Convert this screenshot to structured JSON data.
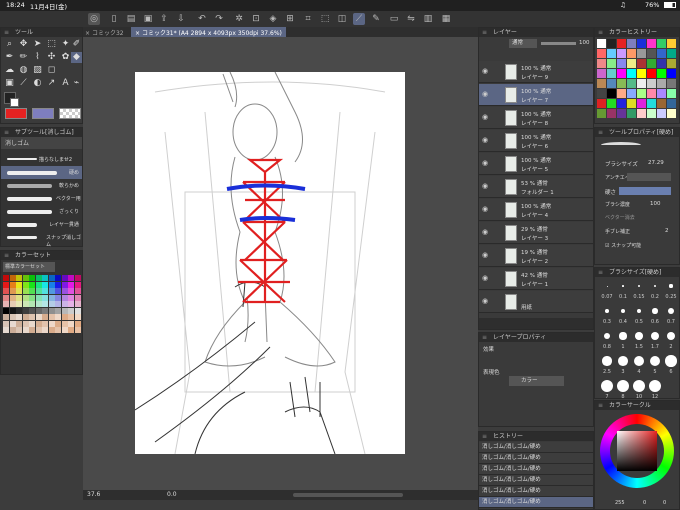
{
  "status": {
    "time": "18:24",
    "date": "11月4日(金)",
    "battery": "76%"
  },
  "tabs": [
    {
      "label": "コミック32"
    },
    {
      "label": "コミック31* (A4 2894 x 4093px 350dpi 37.6%)"
    }
  ],
  "tool_panel": {
    "title": "ツール"
  },
  "subtool": {
    "title": "サブツール[消しゴム]",
    "tab": "消しゴム",
    "items": [
      "描らなしませ2",
      "硬め",
      "軟らかめ",
      "ベクター用",
      "ざっくり",
      "レイヤー貫通",
      "スナップ消しゴム"
    ]
  },
  "color_set": {
    "title": "カラーセット",
    "selector": "標準カラーセット"
  },
  "layer_panel": {
    "title": "レイヤー",
    "blend": "通常",
    "opacity": "100"
  },
  "layers": [
    {
      "op": "100 % 通常",
      "name": "レイヤー 9"
    },
    {
      "op": "100 % 通常",
      "name": "レイヤー 7"
    },
    {
      "op": "100 % 通常",
      "name": "レイヤー 8"
    },
    {
      "op": "100 % 通常",
      "name": "レイヤー 6"
    },
    {
      "op": "100 % 通常",
      "name": "レイヤー 5"
    },
    {
      "op": "53 % 通常",
      "name": "フォルダー 1"
    },
    {
      "op": "100 % 通常",
      "name": "レイヤー 4"
    },
    {
      "op": "29 % 通常",
      "name": "レイヤー 3"
    },
    {
      "op": "19 % 通常",
      "name": "レイヤー 2"
    },
    {
      "op": "42 % 通常",
      "name": "レイヤー 1"
    },
    {
      "op": "",
      "name": "用紙"
    }
  ],
  "layer_property": {
    "title": "レイヤープロパティ",
    "effect": "効果",
    "expression": "表現色",
    "color_mode": "カラー"
  },
  "history": {
    "title": "ヒストリー",
    "items": [
      "消しゴム/消しゴム/硬め",
      "消しゴム/消しゴム/硬め",
      "消しゴム/消しゴム/硬め",
      "消しゴム/消しゴム/硬め",
      "消しゴム/消しゴム/硬め",
      "消しゴム/消しゴム/硬め"
    ]
  },
  "color_history": {
    "title": "カラーヒストリー"
  },
  "tool_property": {
    "title": "ツールプロパティ[硬め]",
    "brush_size_label": "ブラシサイズ",
    "brush_size": "27.29",
    "anti_alias": "アンチエイリアス",
    "hardness": "硬さ",
    "density_label": "ブラシ濃度",
    "density": "100",
    "vector": "ベクター消去",
    "stabilization": "手ブレ補正",
    "stab_val": "2",
    "snap": "スナップ可能"
  },
  "brush_size_panel": {
    "title": "ブラシサイズ[硬め]",
    "sizes": [
      "0.07",
      "0.1",
      "0.15",
      "0.2",
      "0.25",
      "0.3",
      "0.4",
      "0.5",
      "0.6",
      "0.7",
      "0.8",
      "1",
      "1.5",
      "1.7",
      "2",
      "2.5",
      "3",
      "4",
      "5",
      "6",
      "7",
      "8",
      "10",
      "12"
    ]
  },
  "color_circle": {
    "title": "カラーサークル",
    "h": "255",
    "s": "0",
    "v": "0"
  },
  "bottom": {
    "zoom": "37.6",
    "angle": "0.0"
  },
  "colors": {
    "accent": "#5b6684",
    "main_color": "#e52222",
    "sub_color": "#7e7ebe"
  }
}
